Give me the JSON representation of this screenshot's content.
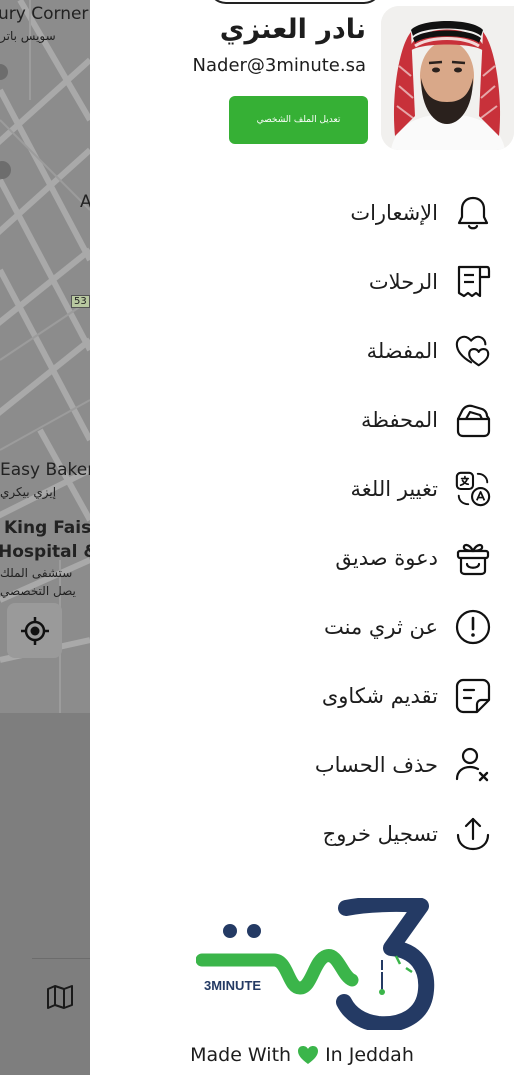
{
  "map": {
    "labels": {
      "luxury_corner": "ury Corner",
      "luxury_corner_ar": "سويس باتر",
      "a_label": "A",
      "road_badge": "53",
      "easy_bakery": "Easy Baker",
      "easy_bakery_ar": "إيزي بيكري",
      "king_faisal": "King Faisa",
      "hospital": "Hospital &.",
      "hospital_ar_1": "ستشفى الملك",
      "hospital_ar_2": "يصل التخصصي"
    }
  },
  "profile": {
    "name": "نادر العنزي",
    "email": "Nader@3minute.sa",
    "edit_button": "تعديل الملف الشخصي"
  },
  "menu": [
    {
      "label": "الإشعارات",
      "icon": "bell-icon"
    },
    {
      "label": "الرحلات",
      "icon": "receipt-icon"
    },
    {
      "label": "المفضلة",
      "icon": "hearts-icon"
    },
    {
      "label": "المحفظة",
      "icon": "wallet-icon"
    },
    {
      "label": "تغيير اللغة",
      "icon": "translate-icon"
    },
    {
      "label": "دعوة صديق",
      "icon": "gift-icon"
    },
    {
      "label": "عن ثري منت",
      "icon": "info-icon"
    },
    {
      "label": "تقديم شكاوى",
      "icon": "note-icon"
    },
    {
      "label": "حذف الحساب",
      "icon": "user-remove-icon"
    },
    {
      "label": "تسجيل خروج",
      "icon": "logout-icon"
    }
  ],
  "logo": {
    "text": "3MINUTE"
  },
  "footer": {
    "made_with": "Made With",
    "in_city": "In Jeddah"
  },
  "colors": {
    "accent_green": "#36b035",
    "logo_navy": "#243a64",
    "logo_green": "#3bb54a"
  }
}
